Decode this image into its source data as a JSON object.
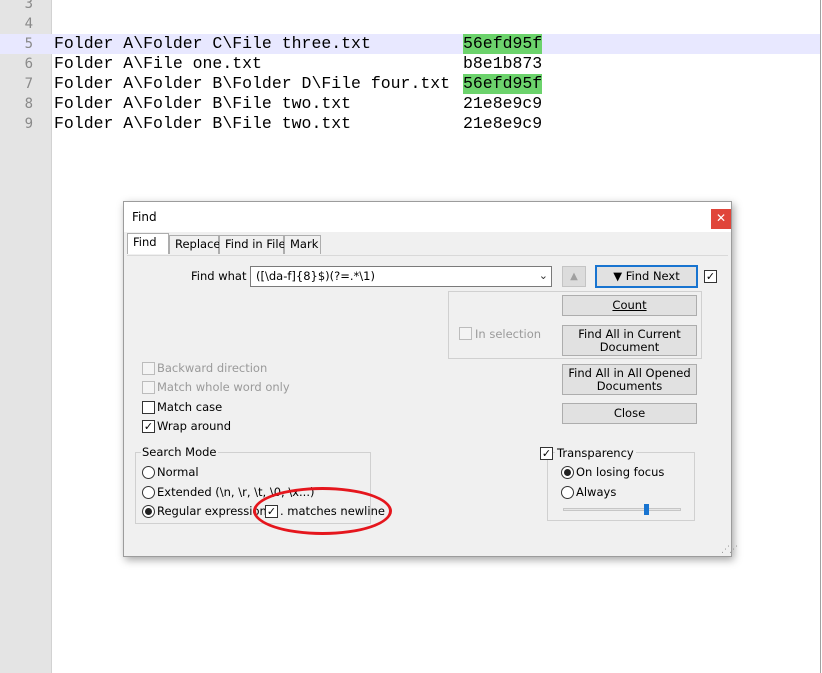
{
  "editor": {
    "lines": [
      {
        "num": "3",
        "text": "",
        "hash": "",
        "highlight": false,
        "current": false
      },
      {
        "num": "4",
        "text": "",
        "hash": "",
        "highlight": false,
        "current": false
      },
      {
        "num": "5",
        "text": "Folder A\\Folder C\\File three.txt",
        "hash": "56efd95f",
        "highlight": true,
        "current": true
      },
      {
        "num": "6",
        "text": "Folder A\\File one.txt",
        "hash": "b8e1b873",
        "highlight": false,
        "current": false
      },
      {
        "num": "7",
        "text": "Folder A\\Folder B\\Folder D\\File four.txt",
        "hash": "56efd95f",
        "highlight": true,
        "current": false
      },
      {
        "num": "8",
        "text": "Folder A\\Folder B\\File two.txt",
        "hash": "21e8e9c9",
        "highlight": false,
        "current": false
      },
      {
        "num": "9",
        "text": "Folder A\\Folder B\\File two.txt",
        "hash": "21e8e9c9",
        "highlight": false,
        "current": false
      }
    ],
    "highlight_color": "#6cd36c",
    "current_line_color": "#e8e8ff"
  },
  "dialog": {
    "title": "Find",
    "close_glyph": "✕",
    "tabs": [
      "Find",
      "Replace",
      "Find in Files",
      "Mark"
    ],
    "active_tab": "Find",
    "find_what_label": "Find what :",
    "find_what_value": "([\\da-f]{8}$)(?=.*\\1)",
    "up_arrow": "▲",
    "find_next_label": "▼ Find Next",
    "count_label": "Count",
    "in_selection_label": "In selection",
    "find_all_current_line1": "Find All in Current",
    "find_all_current_line2": "Document",
    "find_all_opened_line1": "Find All in All Opened",
    "find_all_opened_line2": "Documents",
    "close_label": "Close",
    "options": {
      "backward": "Backward direction",
      "whole_word": "Match whole word only",
      "match_case": "Match case",
      "wrap_around": "Wrap around"
    },
    "search_mode": {
      "title": "Search Mode",
      "normal": "Normal",
      "extended": "Extended (\\n, \\r, \\t, \\0, \\x...)",
      "regex": "Regular expression",
      "matches_newline": ". matches newline"
    },
    "transparency": {
      "label": "Transparency",
      "on_losing_focus": "On losing focus",
      "always": "Always",
      "level": 0.7
    },
    "checked_glyph": "✓",
    "accent_color": "#1874d0",
    "annotation_color": "#e5161d"
  }
}
